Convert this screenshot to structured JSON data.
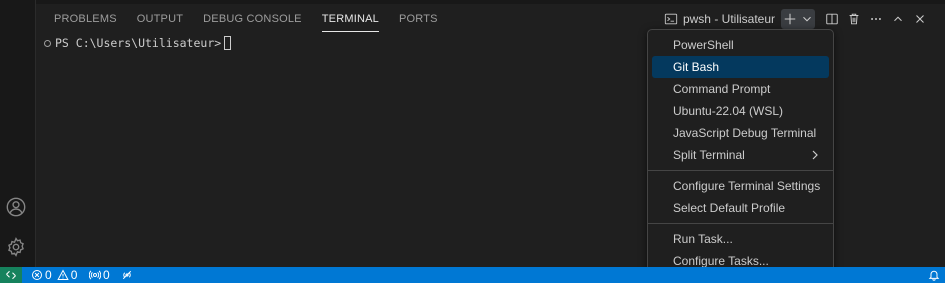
{
  "panel": {
    "tabs": [
      {
        "label": "PROBLEMS"
      },
      {
        "label": "OUTPUT"
      },
      {
        "label": "DEBUG CONSOLE"
      },
      {
        "label": "TERMINAL",
        "active": true
      },
      {
        "label": "PORTS"
      }
    ],
    "terminal_name": "pwsh - Utilisateur",
    "prompt": "PS C:\\Users\\Utilisateur>"
  },
  "menu": {
    "items": [
      {
        "label": "PowerShell"
      },
      {
        "label": "Git Bash",
        "selected": true
      },
      {
        "label": "Command Prompt"
      },
      {
        "label": "Ubuntu-22.04 (WSL)"
      },
      {
        "label": "JavaScript Debug Terminal"
      },
      {
        "label": "Split Terminal",
        "submenu": true
      }
    ],
    "settings_items": [
      {
        "label": "Configure Terminal Settings"
      },
      {
        "label": "Select Default Profile"
      }
    ],
    "task_items": [
      {
        "label": "Run Task..."
      },
      {
        "label": "Configure Tasks..."
      }
    ]
  },
  "status_bar": {
    "errors": "0",
    "warnings": "0",
    "ports": "0"
  },
  "colors": {
    "accent": "#0078d4",
    "remote": "#16825d",
    "selection": "#04395e"
  }
}
